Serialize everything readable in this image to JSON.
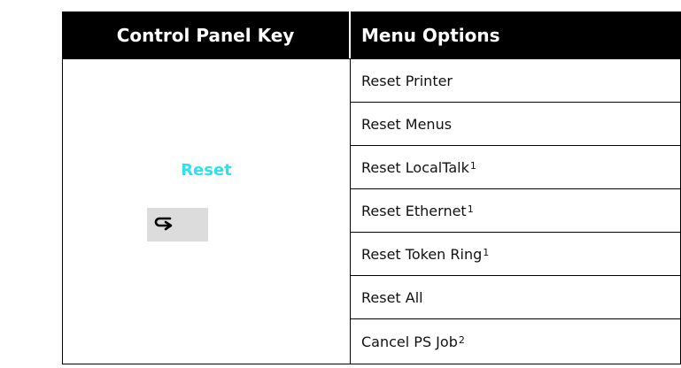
{
  "header": {
    "key_col": "Control Panel Key",
    "menu_col": "Menu Options"
  },
  "key": {
    "label": "Reset",
    "button_icon": "return-arrow-icon"
  },
  "menu_items": [
    {
      "label": "Reset Printer",
      "sup": ""
    },
    {
      "label": "Reset Menus",
      "sup": ""
    },
    {
      "label": "Reset LocalTalk",
      "sup": "1"
    },
    {
      "label": "Reset Ethernet",
      "sup": "1"
    },
    {
      "label": "Reset Token Ring",
      "sup": "1"
    },
    {
      "label": "Reset All",
      "sup": ""
    },
    {
      "label": "Cancel PS Job",
      "sup": "2"
    }
  ],
  "colors": {
    "header_bg": "#000000",
    "header_text": "#ffffff",
    "key_label": "#2fe0f2",
    "key_button_bg": "#dcdcdc"
  }
}
